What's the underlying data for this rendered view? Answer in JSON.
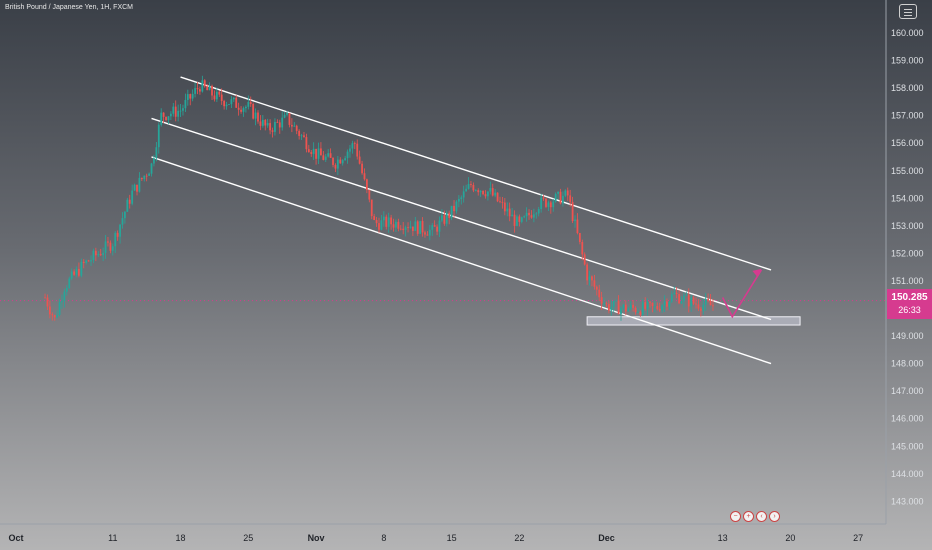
{
  "header": {
    "symbol_label": "British Pound / Japanese Yen, 1H, FXCM"
  },
  "price_tag": {
    "price": "150.285",
    "countdown": "26:33"
  },
  "colors": {
    "up": "#26a69a",
    "down": "#ef5350",
    "accent": "#d63b8f",
    "channel": "#ffffff"
  },
  "icons": {
    "settings": "settings-icon",
    "nav": [
      "zoom-out-icon",
      "zoom-in-icon",
      "scroll-left-icon",
      "scroll-right-icon"
    ]
  },
  "chart_data": {
    "type": "candlestick",
    "y_ticks": [
      "160.000",
      "159.000",
      "158.000",
      "157.000",
      "156.000",
      "155.000",
      "154.000",
      "153.000",
      "152.000",
      "151.000",
      "150.000",
      "149.000",
      "148.000",
      "147.000",
      "146.000",
      "145.000",
      "144.000",
      "143.000"
    ],
    "x_ticks": [
      "Oct",
      "11",
      "18",
      "25",
      "Nov",
      "8",
      "15",
      "22",
      "Dec",
      "13",
      "20",
      "27"
    ],
    "ylim": [
      142.2,
      161.0
    ],
    "current_price": 150.285,
    "price_path": [
      [
        "Oct 4",
        150.4
      ],
      [
        "Oct 5",
        149.6
      ],
      [
        "Oct 6",
        150.8
      ],
      [
        "Oct 8",
        151.6
      ],
      [
        "Oct 11",
        152.4
      ],
      [
        "Oct 13",
        154.2
      ],
      [
        "Oct 15",
        155.2
      ],
      [
        "Oct 16",
        157.0
      ],
      [
        "Oct 18",
        157.2
      ],
      [
        "Oct 20",
        158.1
      ],
      [
        "Oct 22",
        157.6
      ],
      [
        "Oct 25",
        157.3
      ],
      [
        "Oct 27",
        156.5
      ],
      [
        "Oct 29",
        156.9
      ],
      [
        "Nov 1",
        155.6
      ],
      [
        "Nov 3",
        155.3
      ],
      [
        "Nov 5",
        156.0
      ],
      [
        "Nov 7",
        153.1
      ],
      [
        "Nov 10",
        153.1
      ],
      [
        "Nov 13",
        152.8
      ],
      [
        "Nov 15",
        153.5
      ],
      [
        "Nov 17",
        154.5
      ],
      [
        "Nov 19",
        154.2
      ],
      [
        "Nov 22",
        153.0
      ],
      [
        "Nov 24",
        153.8
      ],
      [
        "Nov 27",
        154.1
      ],
      [
        "Nov 29",
        151.2
      ],
      [
        "Dec 1",
        150.1
      ],
      [
        "Dec 3",
        150.0
      ],
      [
        "Dec 6",
        150.0
      ],
      [
        "Dec 8",
        150.5
      ],
      [
        "Dec 10",
        150.2
      ],
      [
        "Dec 12",
        150.1
      ]
    ],
    "channel_lines": [
      {
        "name": "upper",
        "from": [
          "Oct 18",
          158.4
        ],
        "to": [
          "Dec 18",
          151.4
        ]
      },
      {
        "name": "middle",
        "from": [
          "Oct 15",
          156.9
        ],
        "to": [
          "Dec 18",
          149.6
        ]
      },
      {
        "name": "lower",
        "from": [
          "Oct 15",
          155.5
        ],
        "to": [
          "Dec 18",
          148.0
        ]
      }
    ],
    "support_zone": {
      "from": "Nov 29",
      "to": "Dec 21",
      "low": 149.4,
      "high": 149.7
    },
    "projection": [
      [
        "Dec 13",
        150.4
      ],
      [
        "Dec 14",
        149.7
      ],
      [
        "Dec 17",
        151.4
      ]
    ],
    "grid": false
  }
}
